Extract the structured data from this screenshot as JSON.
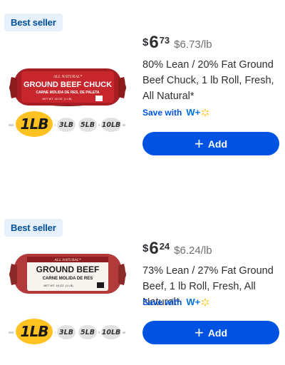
{
  "products": [
    {
      "badge": "Best seller",
      "price_currency": "$",
      "price_dollars": "6",
      "price_cents": "73",
      "unit_price": "$6.73/lb",
      "title": "80% Lean / 20% Fat Ground Beef Chuck, 1 lb Roll, Fresh, All Natural*",
      "save_with": "Save with",
      "wplus": "W+",
      "add_label": "Add",
      "package": {
        "top_text": "ALL NATURAL*",
        "name": "GROUND BEEF CHUCK",
        "sub": "CARNE MOLIDA DE RES, DE PALETA",
        "weight": "NET WT. 16 OZ. (1 LB)",
        "style": "red"
      },
      "sizes": {
        "selected": "1LB",
        "options": [
          "3LB",
          "5LB",
          "10LB"
        ]
      }
    },
    {
      "badge": "Best seller",
      "price_currency": "$",
      "price_dollars": "6",
      "price_cents": "24",
      "unit_price": "$6.24/lb",
      "title": "73% Lean / 27% Fat Ground Beef, 1 lb Roll, Fresh, All Natural*",
      "save_with": "Save with",
      "wplus": "W+",
      "add_label": "Add",
      "package": {
        "top_text": "ALL NATURAL*",
        "name": "GROUND BEEF",
        "sub": "CARNE MOLIDA DE RES",
        "weight": "NET WT. 16 OZ. (1 LB)",
        "style": "white"
      },
      "sizes": {
        "selected": "1LB",
        "options": [
          "3LB",
          "5LB",
          "10LB"
        ]
      }
    }
  ],
  "colors": {
    "accent": "#0053e2",
    "badge_bg": "#e6f1fc",
    "badge_text": "#004f9a",
    "spark": "#ffc220"
  },
  "icons": {
    "add": "plus-icon",
    "wplus_spark": "spark-icon"
  }
}
